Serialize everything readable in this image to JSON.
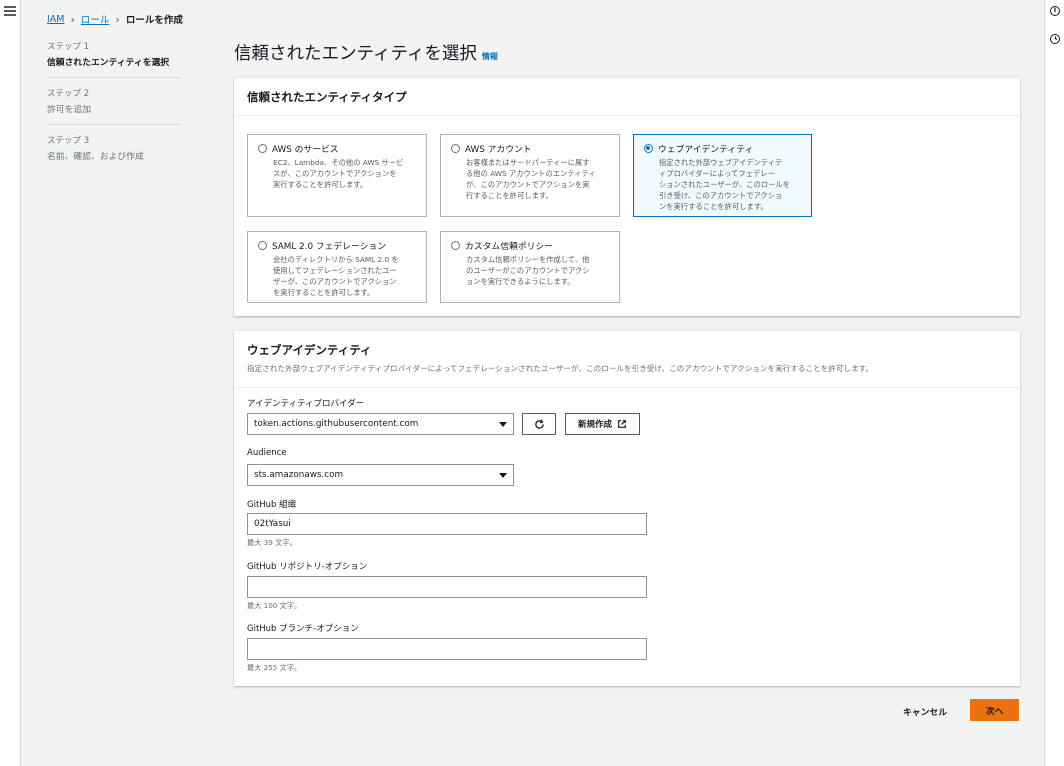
{
  "breadcrumb": {
    "items": [
      "IAM",
      "ロール"
    ],
    "current": "ロールを作成"
  },
  "steps": [
    {
      "label": "ステップ 1",
      "title": "信頼されたエンティティを選択",
      "active": true
    },
    {
      "label": "ステップ 2",
      "title": "許可を追加",
      "active": false
    },
    {
      "label": "ステップ 3",
      "title": "名前、確認、および作成",
      "active": false
    }
  ],
  "page": {
    "title": "信頼されたエンティティを選択",
    "info": "情報"
  },
  "entity_type_panel": {
    "title": "信頼されたエンティティタイプ",
    "options": [
      {
        "name": "AWS のサービス",
        "desc": [
          "EC2、Lambda、その他の AWS サービ",
          "スが、このアカウントでアクションを",
          "実行することを許可します。"
        ],
        "selected": false
      },
      {
        "name": "AWS アカウント",
        "desc": [
          "お客様またはサードパーティーに属す",
          "る他の AWS アカウントのエンティティ",
          "が、このアカウントでアクションを実",
          "行することを許可します。"
        ],
        "selected": false
      },
      {
        "name": "ウェブアイデンティティ",
        "desc": [
          "指定された外部ウェブアイデンティテ",
          "ィプロバイダーによってフェデレー",
          "ションされたユーザーが、このロールを",
          "引き受け、このアカウントでアクショ",
          "ンを実行することを許可します。"
        ],
        "selected": true
      },
      {
        "name": "SAML 2.0 フェデレーション",
        "desc": [
          "会社のディレクトリから SAML 2.0 を",
          "使用してフェデレーションされたユー",
          "ザーが、このアカウントでアクション",
          "を実行することを許可します。"
        ],
        "selected": false
      },
      {
        "name": "カスタム信頼ポリシー",
        "desc": [
          "カスタム信頼ポリシーを作成して、他",
          "のユーザーがこのアカウントでアクシ",
          "ョンを実行できるようにします。"
        ],
        "selected": false
      }
    ]
  },
  "web_identity_panel": {
    "title": "ウェブアイデンティティ",
    "description": "指定された外部ウェブアイデンティティプロバイダーによってフェデレーションされたユーザーが、このロールを引き受け、このアカウントでアクションを実行することを許可します。",
    "provider_label": "アイデンティティプロバイダー",
    "provider_value": "token.actions.githubusercontent.com",
    "new_button": "新規作成",
    "audience_label": "Audience",
    "audience_value": "sts.amazonaws.com",
    "org_label": "GitHub 組織",
    "org_value": "02tYasui",
    "org_constraint": "最大 39 文字。",
    "repo_label": "GitHub リポジトリ-オプション",
    "repo_value": "",
    "repo_constraint": "最大 100 文字。",
    "branch_label": "GitHub ブランチ-オプション",
    "branch_value": "",
    "branch_constraint": "最大 255 文字。"
  },
  "actions": {
    "cancel": "キャンセル",
    "next": "次へ"
  },
  "colors": {
    "link": "#0073bb",
    "primary_button": "#ec7211",
    "selected_tile_bg": "#f1faff"
  },
  "icons": {
    "menu": "hamburger-menu-icon",
    "info": "info-icon",
    "history": "history-icon",
    "refresh": "refresh-icon",
    "external": "external-link-icon"
  }
}
